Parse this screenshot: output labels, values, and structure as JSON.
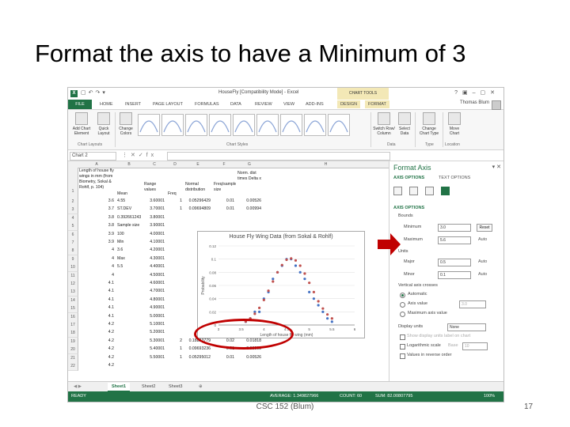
{
  "slide": {
    "title": "Format the axis to have a Minimum of 3",
    "footer": "CSC 152 (Blum)",
    "page_number": "17"
  },
  "excel": {
    "window_title": "HouseFly  [Compatibility Mode] - Excel",
    "chart_tools": "CHART TOOLS",
    "tabs": [
      "FILE",
      "HOME",
      "INSERT",
      "PAGE LAYOUT",
      "FORMULAS",
      "DATA",
      "REVIEW",
      "VIEW",
      "ADD-INS",
      "DESIGN",
      "FORMAT"
    ],
    "user": "Thomas Blum",
    "ribbon": {
      "add_chart_element": "Add Chart Element",
      "quick_layout": "Quick Layout",
      "change_colors": "Change Colors",
      "switch_row_column": "Switch Row/ Column",
      "select_data": "Select Data",
      "change_chart_type": "Change Chart Type",
      "move_chart": "Move Chart",
      "group_chart_layouts": "Chart Layouts",
      "group_chart_styles": "Chart Styles",
      "group_data": "Data",
      "group_type": "Type",
      "group_location": "Location"
    },
    "name_box": "Chart 2",
    "fx": "fx",
    "columns": [
      "A",
      "B",
      "C",
      "D",
      "E",
      "F",
      "G",
      "H"
    ],
    "header_cells": {
      "a1": "Length of house fly wings in mm (from Biometry, Sokal & Rohlf, p. 104)",
      "b1": "Mean",
      "c1": "Range values",
      "d1": "Freq",
      "e1": "Normal distribution",
      "f1": "Freq/sample size",
      "g1": "Norm. dist times Delta x"
    },
    "rows": [
      {
        "n": "2",
        "a": "3.6",
        "b": "4.55",
        "c": "3.60001",
        "d": "1",
        "e": "0.05296429",
        "f": "0.01",
        "g": "0.00526"
      },
      {
        "n": "3",
        "a": "3.7",
        "b": "ST.DEV",
        "c": "3.70001",
        "d": "1",
        "e": "0.09694809",
        "f": "0.01",
        "g": "0.00994"
      },
      {
        "n": "4",
        "a": "3.8",
        "b": "0.392661243",
        "c": "3.80001",
        "d": "",
        "e": "",
        "f": "",
        "g": ""
      },
      {
        "n": "5",
        "a": "3.8",
        "b": "Sample size",
        "c": "3.90001",
        "d": "",
        "e": "",
        "f": "",
        "g": ""
      },
      {
        "n": "6",
        "a": "3.9",
        "b": "100",
        "c": "4.00001",
        "d": "",
        "e": "",
        "f": "",
        "g": ""
      },
      {
        "n": "7",
        "a": "3.9",
        "b": "Min",
        "c": "4.10001",
        "d": "",
        "e": "",
        "f": "",
        "g": ""
      },
      {
        "n": "8",
        "a": "4",
        "b": "3.6",
        "c": "4.20001",
        "d": "",
        "e": "",
        "f": "",
        "g": ""
      },
      {
        "n": "9",
        "a": "4",
        "b": "Max",
        "c": "4.30001",
        "d": "",
        "e": "",
        "f": "",
        "g": ""
      },
      {
        "n": "10",
        "a": "4",
        "b": "5.5",
        "c": "4.40001",
        "d": "",
        "e": "",
        "f": "",
        "g": ""
      },
      {
        "n": "11",
        "a": "4",
        "b": "",
        "c": "4.50001",
        "d": "",
        "e": "",
        "f": "",
        "g": ""
      },
      {
        "n": "12",
        "a": "4.1",
        "b": "",
        "c": "4.60001",
        "d": "",
        "e": "",
        "f": "",
        "g": ""
      },
      {
        "n": "13",
        "a": "4.1",
        "b": "",
        "c": "4.70001",
        "d": "",
        "e": "",
        "f": "",
        "g": ""
      },
      {
        "n": "14",
        "a": "4.1",
        "b": "",
        "c": "4.80001",
        "d": "",
        "e": "",
        "f": "",
        "g": ""
      },
      {
        "n": "15",
        "a": "4.1",
        "b": "",
        "c": "4.90001",
        "d": "",
        "e": "",
        "f": "",
        "g": ""
      },
      {
        "n": "16",
        "a": "4.1",
        "b": "",
        "c": "5.00001",
        "d": "",
        "e": "",
        "f": "",
        "g": ""
      },
      {
        "n": "17",
        "a": "4.2",
        "b": "",
        "c": "5.10001",
        "d": "",
        "e": "",
        "f": "",
        "g": ""
      },
      {
        "n": "18",
        "a": "4.2",
        "b": "",
        "c": "5.20001",
        "d": "",
        "e": "",
        "f": "",
        "g": ""
      },
      {
        "n": "19",
        "a": "4.2",
        "b": "",
        "c": "5.30001",
        "d": "2",
        "e": "0.18823779",
        "f": "0.02",
        "g": "0.01818"
      },
      {
        "n": "20",
        "a": "4.2",
        "b": "",
        "c": "5.40001",
        "d": "1",
        "e": "0.09693236",
        "f": "0.01",
        "g": "0.00993"
      },
      {
        "n": "21",
        "a": "4.2",
        "b": "",
        "c": "5.50001",
        "d": "1",
        "e": "0.05295012",
        "f": "0.01",
        "g": "0.00526"
      },
      {
        "n": "22",
        "a": "4.2",
        "b": "",
        "c": "",
        "d": "",
        "e": "",
        "f": "",
        "g": ""
      }
    ],
    "sheet_tabs": [
      "Sheet1",
      "Sheet2",
      "Sheet3"
    ],
    "status": {
      "ready": "READY",
      "average": "AVERAGE: 1.349827966",
      "count": "COUNT: 60",
      "sum": "SUM: 82.00807795",
      "zoom": "100%"
    }
  },
  "format_axis": {
    "title": "Format Axis",
    "tab_axis_options": "AXIS OPTIONS",
    "tab_text_options": "TEXT OPTIONS",
    "section": "AXIS OPTIONS",
    "bounds_label": "Bounds",
    "minimum_label": "Minimum",
    "minimum_value": "3.0",
    "minimum_action": "Reset",
    "maximum_label": "Maximum",
    "maximum_value": "5.6",
    "maximum_action": "Auto",
    "units_label": "Units",
    "major_label": "Major",
    "major_value": "0.5",
    "major_action": "Auto",
    "minor_label": "Minor",
    "minor_value": "0.1",
    "minor_action": "Auto",
    "vertical_crosses_label": "Vertical axis crosses",
    "automatic": "Automatic",
    "axis_value": "Axis value",
    "axis_value_box": "3.0",
    "max_axis_value": "Maximum axis value",
    "display_units_label": "Display units",
    "display_units_value": "None",
    "show_units_label": "Show display units label on chart",
    "log_scale": "Logarithmic scale",
    "base_label": "Base",
    "base_value": "10",
    "reverse_order": "Values in reverse order"
  },
  "chart_data": {
    "type": "scatter",
    "title": "House Fly Wing Data (from Sokal & Rohlf)",
    "xlabel": "Length of house fly wing (mm)",
    "ylabel": "Probability",
    "xlim": [
      3,
      6
    ],
    "ylim": [
      0,
      0.12
    ],
    "x_ticks": [
      "3",
      "3.5",
      "4",
      "4.5",
      "5",
      "5.5",
      "6"
    ],
    "y_ticks": [
      "0",
      "0.02",
      "0.04",
      "0.06",
      "0.08",
      "0.1",
      "0.12"
    ],
    "series": [
      {
        "color": "#4472c4",
        "x": [
          3.6,
          3.7,
          3.8,
          3.9,
          4.0,
          4.1,
          4.2,
          4.3,
          4.4,
          4.5,
          4.6,
          4.7,
          4.8,
          4.9,
          5.0,
          5.1,
          5.2,
          5.3,
          5.4,
          5.5
        ],
        "y": [
          0.005,
          0.01,
          0.02,
          0.02,
          0.04,
          0.05,
          0.07,
          0.08,
          0.09,
          0.1,
          0.1,
          0.09,
          0.08,
          0.07,
          0.05,
          0.04,
          0.03,
          0.02,
          0.01,
          0.005
        ]
      },
      {
        "color": "#c0504d",
        "x": [
          3.6,
          3.7,
          3.8,
          3.9,
          4.0,
          4.1,
          4.2,
          4.3,
          4.4,
          4.5,
          4.6,
          4.7,
          4.8,
          4.9,
          5.0,
          5.1,
          5.2,
          5.3,
          5.4,
          5.5
        ],
        "y": [
          0.0053,
          0.0099,
          0.017,
          0.026,
          0.038,
          0.052,
          0.066,
          0.08,
          0.091,
          0.099,
          0.101,
          0.098,
          0.09,
          0.078,
          0.064,
          0.05,
          0.036,
          0.025,
          0.016,
          0.0099
        ]
      }
    ]
  }
}
